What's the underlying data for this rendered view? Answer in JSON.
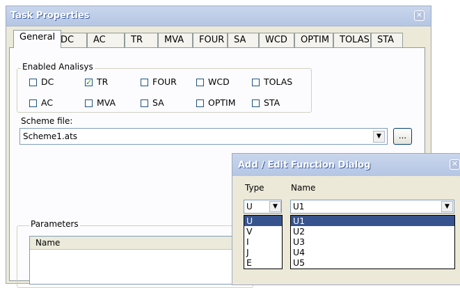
{
  "window": {
    "title": "Task Properties"
  },
  "tabs": [
    {
      "label": "General",
      "active": true
    },
    {
      "label": "DC"
    },
    {
      "label": "AC"
    },
    {
      "label": "TR"
    },
    {
      "label": "MVA"
    },
    {
      "label": "FOUR"
    },
    {
      "label": "SA"
    },
    {
      "label": "WCD"
    },
    {
      "label": "OPTIM"
    },
    {
      "label": "TOLAS"
    },
    {
      "label": "STA"
    }
  ],
  "enabled": {
    "legend": "Enabled Analisys",
    "items": [
      {
        "label": "DC",
        "checked": false
      },
      {
        "label": "TR",
        "checked": true
      },
      {
        "label": "FOUR",
        "checked": false
      },
      {
        "label": "WCD",
        "checked": false
      },
      {
        "label": "TOLAS",
        "checked": false
      },
      {
        "label": "AC",
        "checked": false
      },
      {
        "label": "MVA",
        "checked": false
      },
      {
        "label": "SA",
        "checked": false
      },
      {
        "label": "OPTIM",
        "checked": false
      },
      {
        "label": "STA",
        "checked": false
      }
    ]
  },
  "scheme": {
    "label": "Scheme file:",
    "value": "Scheme1.ats",
    "browse_label": "..."
  },
  "parameters": {
    "legend": "Parameters",
    "column_name": "Name"
  },
  "dialog": {
    "title": "Add / Edit Function Dialog",
    "type_label": "Type",
    "name_label": "Name",
    "type_value": "U",
    "name_value": "U1",
    "type_options": [
      "U",
      "V",
      "I",
      "J",
      "E"
    ],
    "name_options": [
      "U1",
      "U2",
      "U3",
      "U4",
      "U5"
    ]
  },
  "colors": {
    "selection": "#36538d",
    "title_bar": "#b4c6e4"
  }
}
